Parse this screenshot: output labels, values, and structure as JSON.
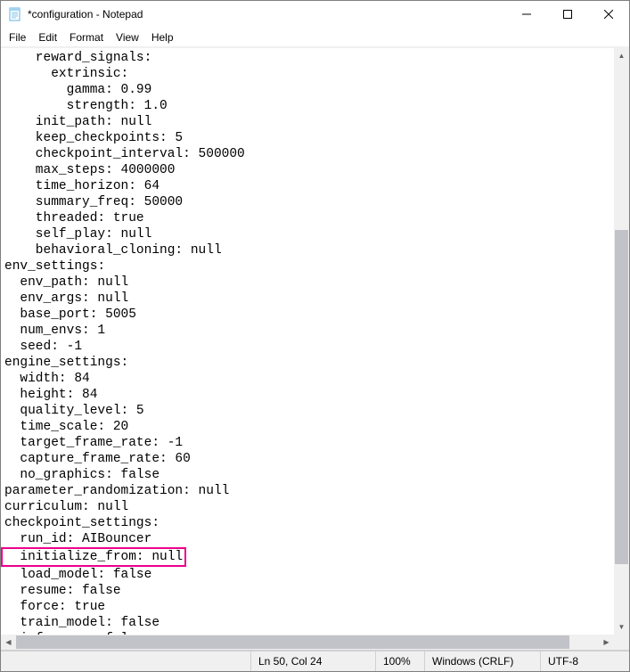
{
  "window": {
    "title": "*configuration - Notepad"
  },
  "menu": {
    "file": "File",
    "edit": "Edit",
    "format": "Format",
    "view": "View",
    "help": "Help"
  },
  "editor": {
    "lines": [
      "    reward_signals:",
      "      extrinsic:",
      "        gamma: 0.99",
      "        strength: 1.0",
      "    init_path: null",
      "    keep_checkpoints: 5",
      "    checkpoint_interval: 500000",
      "    max_steps: 4000000",
      "    time_horizon: 64",
      "    summary_freq: 50000",
      "    threaded: true",
      "    self_play: null",
      "    behavioral_cloning: null",
      "env_settings:",
      "  env_path: null",
      "  env_args: null",
      "  base_port: 5005",
      "  num_envs: 1",
      "  seed: -1",
      "engine_settings:",
      "  width: 84",
      "  height: 84",
      "  quality_level: 5",
      "  time_scale: 20",
      "  target_frame_rate: -1",
      "  capture_frame_rate: 60",
      "  no_graphics: false",
      "parameter_randomization: null",
      "curriculum: null",
      "checkpoint_settings:",
      "  run_id: AIBouncer"
    ],
    "highlighted_line": "  initialize_from: null",
    "lines_after": [
      "  load_model: false",
      "  resume: false",
      "  force: true",
      "  train_model: false",
      "  inference: false"
    ]
  },
  "statusbar": {
    "position": "Ln 50, Col 24",
    "zoom": "100%",
    "line_ending": "Windows (CRLF)",
    "encoding": "UTF-8"
  },
  "highlight_color": "#ec008c"
}
